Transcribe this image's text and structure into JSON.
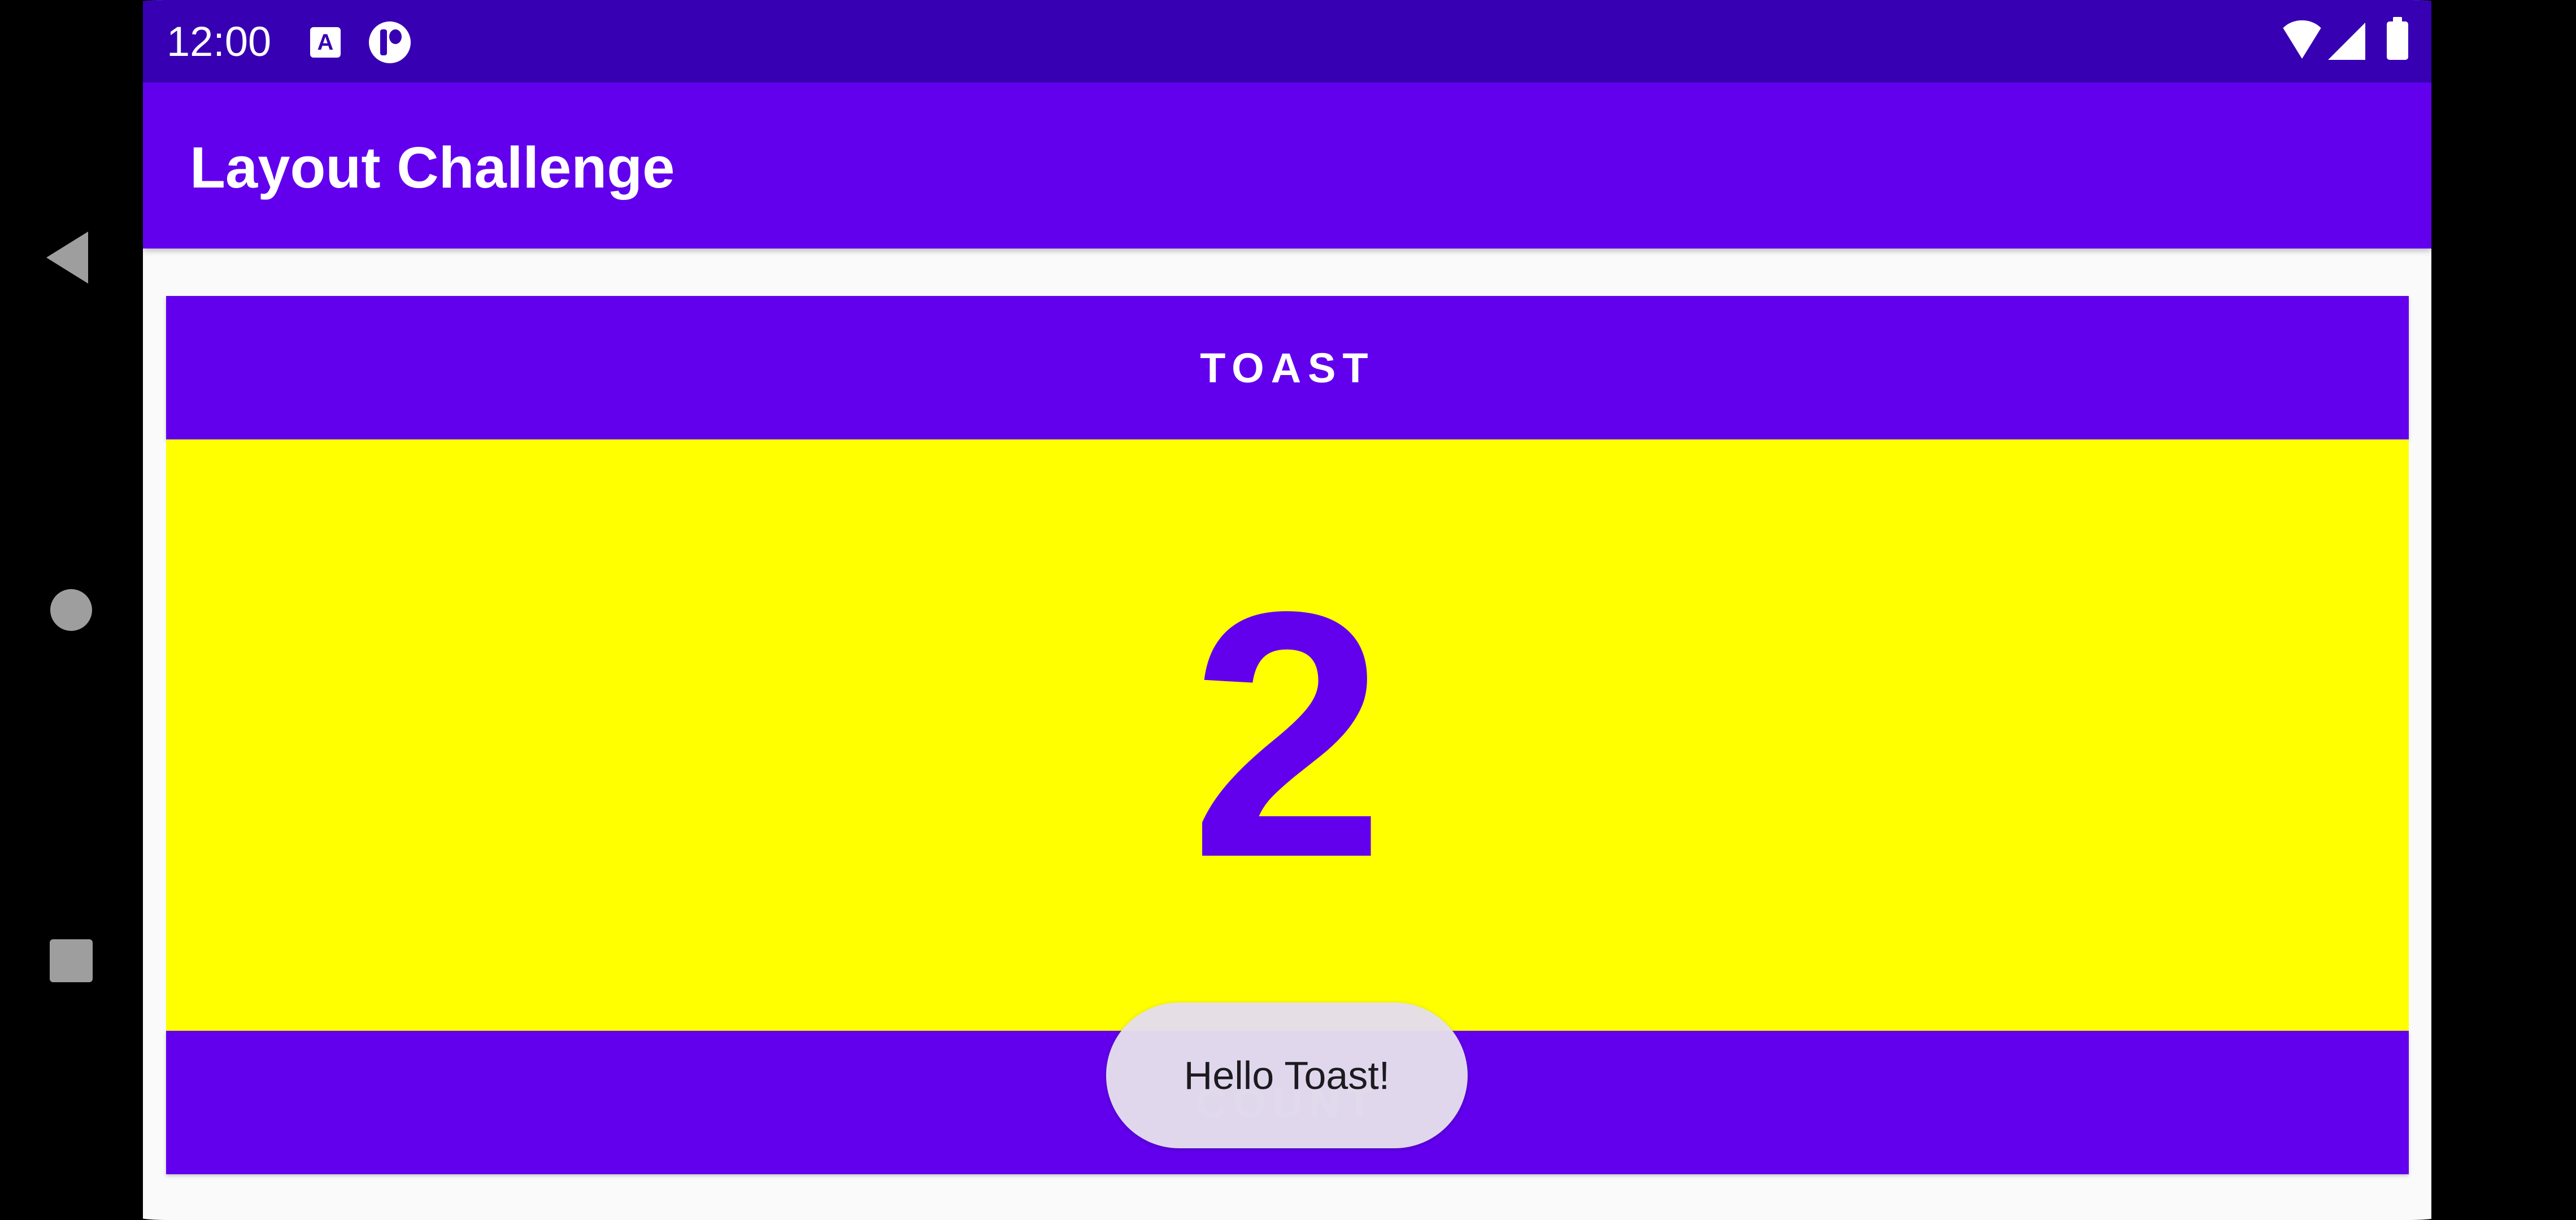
{
  "status_bar": {
    "time": "12:00",
    "notification_icons": [
      "a-notification-icon",
      "p-notification-icon"
    ],
    "system_icons": [
      "wifi-icon",
      "signal-icon",
      "battery-icon"
    ]
  },
  "nav_bar": {
    "buttons": [
      "back-icon",
      "home-icon",
      "recents-icon"
    ]
  },
  "app_bar": {
    "title": "Layout Challenge"
  },
  "main": {
    "toast_button_label": "TOAST",
    "count_value": "2",
    "count_button_label": "COUNT"
  },
  "toast": {
    "message": "Hello Toast!"
  },
  "colors": {
    "status_bar": "#3700b3",
    "primary": "#6200ee",
    "count_background": "#ffff00",
    "count_text": "#6200ee"
  }
}
